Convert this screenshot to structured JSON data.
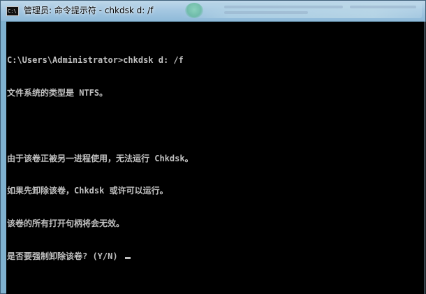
{
  "window": {
    "title": "管理员: 命令提示符 - chkdsk  d: /f",
    "icon_text": "C:\\"
  },
  "console": {
    "lines": [
      "C:\\Users\\Administrator>chkdsk d: /f",
      "文件系统的类型是 NTFS。",
      "",
      "由于该卷正被另一进程使用，无法运行 Chkdsk。",
      "如果先卸除该卷，Chkdsk 或许可以运行。",
      "该卷的所有打开句柄将会无效。",
      "是否要强制卸除该卷? (Y/N) "
    ]
  },
  "colors": {
    "console_bg": "#000000",
    "console_fg": "#c0c0c0",
    "titlebar": "#a6c8e2"
  }
}
